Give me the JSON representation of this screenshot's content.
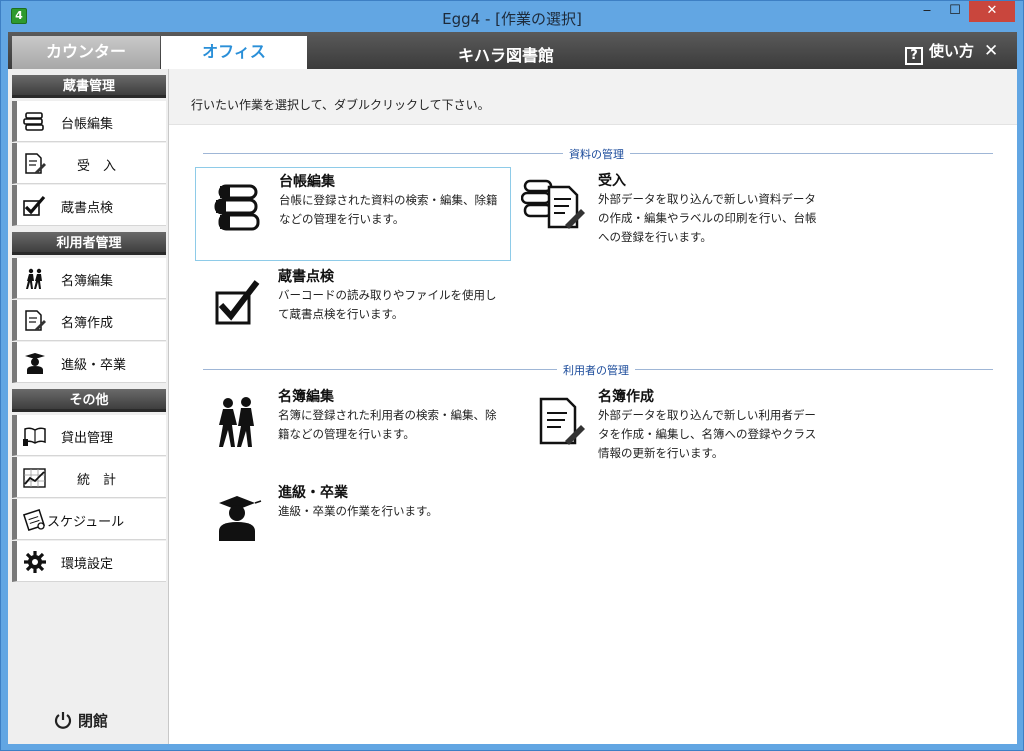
{
  "window": {
    "title": "Egg4 - [作業の選択]",
    "app_icon_text": "4",
    "minimize": "‒",
    "maximize": "☐",
    "close": "✕"
  },
  "header": {
    "tabs": [
      {
        "label": "カウンター",
        "active": false
      },
      {
        "label": "オフィス",
        "active": true
      }
    ],
    "library_name": "キハラ図書館",
    "help_icon": "?",
    "help_label": "使い方",
    "close": "✕"
  },
  "sidebar": {
    "sections": [
      {
        "title": "蔵書管理",
        "items": [
          {
            "label": "台帳編集",
            "icon": "books-icon"
          },
          {
            "label": "受　入",
            "icon": "document-pen-icon"
          },
          {
            "label": "蔵書点検",
            "icon": "checkmark-icon"
          }
        ]
      },
      {
        "title": "利用者管理",
        "items": [
          {
            "label": "名簿編集",
            "icon": "people-walking-icon"
          },
          {
            "label": "名簿作成",
            "icon": "document-pen-icon"
          },
          {
            "label": "進級・卒業",
            "icon": "graduate-icon"
          }
        ]
      },
      {
        "title": "その他",
        "items": [
          {
            "label": "貸出管理",
            "icon": "book-hand-icon"
          },
          {
            "label": "統　計",
            "icon": "chart-icon"
          },
          {
            "label": "スケジュール",
            "icon": "calendar-icon"
          },
          {
            "label": "環境設定",
            "icon": "gear-icon"
          }
        ]
      }
    ],
    "close_label": "閉館"
  },
  "main": {
    "instruction": "行いたい作業を選択して、ダブルクリックして下さい。",
    "sections": [
      {
        "title": "資料の管理",
        "tasks": [
          {
            "title": "台帳編集",
            "desc": "台帳に登録された資料の検索・編集、除籍などの管理を行います。",
            "icon": "books-icon",
            "selected": true
          },
          {
            "title": "受入",
            "desc": "外部データを取り込んで新しい資料データの作成・編集やラベルの印刷を行い、台帳への登録を行います。",
            "icon": "books-document-icon",
            "selected": false
          },
          {
            "title": "蔵書点検",
            "desc": "バーコードの読み取りやファイルを使用して蔵書点検を行います。",
            "icon": "checkmark-icon",
            "selected": false
          }
        ]
      },
      {
        "title": "利用者の管理",
        "tasks": [
          {
            "title": "名簿編集",
            "desc": "名簿に登録された利用者の検索・編集、除籍などの管理を行います。",
            "icon": "people-walking-icon",
            "selected": false
          },
          {
            "title": "名簿作成",
            "desc": "外部データを取り込んで新しい利用者データを作成・編集し、名簿への登録やクラス情報の更新を行います。",
            "icon": "document-pen-icon",
            "selected": false
          },
          {
            "title": "進級・卒業",
            "desc": "進級・卒業の作業を行います。",
            "icon": "graduate-icon",
            "selected": false
          }
        ]
      }
    ]
  }
}
